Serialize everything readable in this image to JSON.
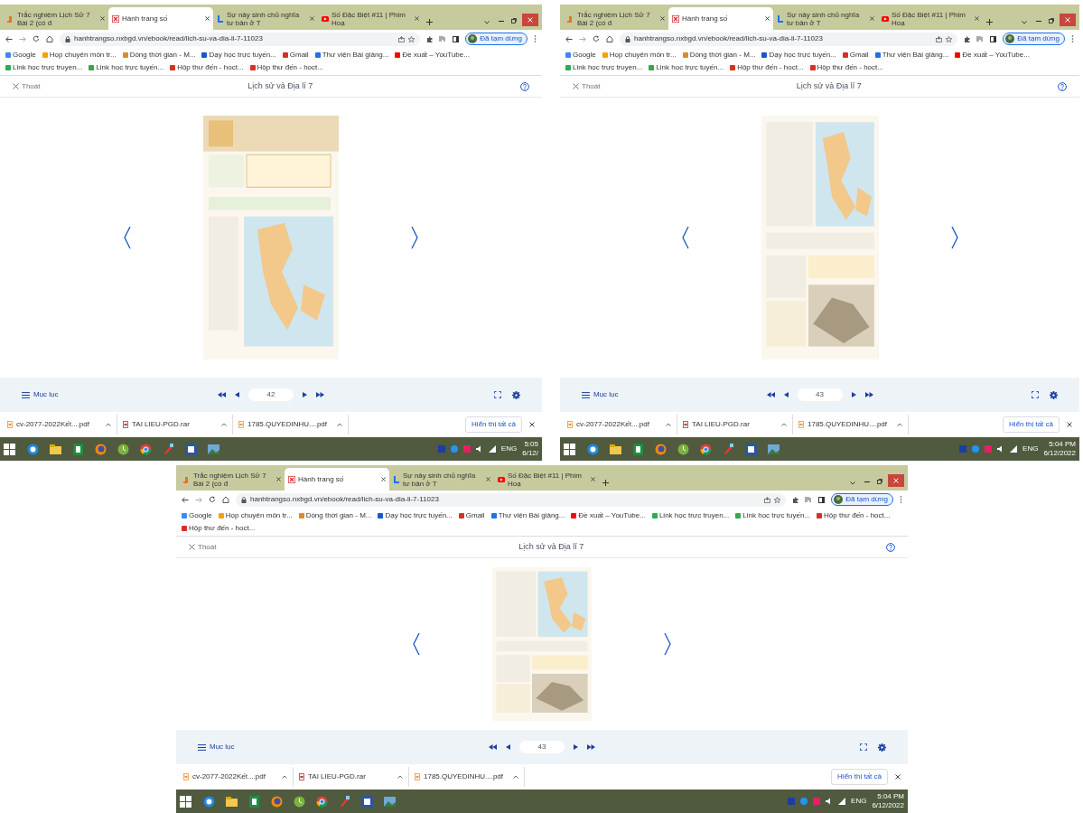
{
  "panels": [
    {
      "tabs": [
        {
          "label": "Trắc nghiệm Lịch Sử 7 Bài 2 (có đ",
          "selected": false
        },
        {
          "label": "Hành trang số",
          "selected": true
        },
        {
          "label": "Sự nảy sinh chủ nghĩa tư bản ở T",
          "selected": false
        },
        {
          "label": "Số Đặc Biệt #11 | Phim Hoạ",
          "selected": false
        }
      ],
      "url": "hanhtrangso.nxbgd.vn/ebook/read/lich-su-va-dia-li-7-11023",
      "profile": "Đã tạm dừng",
      "bookmarks": [
        "Google",
        "Họp chuyên môn tr...",
        "Dòng thời gian - M...",
        "Dạy học trực tuyến...",
        "Gmail",
        "Thư viện Bài giảng...",
        "Đề xuất – YouTube...",
        "Link học trực truyen...",
        "Link học trực tuyến...",
        "Hộp thư đến - hoct...",
        "Hộp thư đến - hoct..."
      ],
      "exit": "Thoát",
      "title": "Lịch sử và Địa lí 7",
      "toc": "Mục lục",
      "page": "42",
      "downloads": [
        "cv-2077-2022Kết....pdf",
        "TAI LIEU-PGD.rar",
        "1785.QUYEDINHU....pdf"
      ],
      "show_all": "Hiển thị tất cả",
      "lang": "ENG",
      "time": "5:05",
      "date": "6/12/"
    },
    {
      "tabs": [
        {
          "label": "Trắc nghiệm Lịch Sử 7 Bài 2 (có đ",
          "selected": false
        },
        {
          "label": "Hành trang số",
          "selected": true
        },
        {
          "label": "Sự nảy sinh chủ nghĩa tư bản ở T",
          "selected": false
        },
        {
          "label": "Số Đặc Biệt #11 | Phim Hoạ",
          "selected": false
        }
      ],
      "url": "hanhtrangso.nxbgd.vn/ebook/read/lich-su-va-dia-li-7-11023",
      "profile": "Đã tạm dừng",
      "bookmarks": [
        "Google",
        "Họp chuyên môn tr...",
        "Dòng thời gian - M...",
        "Dạy học trực tuyến...",
        "Gmail",
        "Thư viện Bài giảng...",
        "Đề xuất – YouTube...",
        "Link học trực truyen...",
        "Link học trực tuyến...",
        "Hộp thư đến - hoct...",
        "Hộp thư đến - hoct..."
      ],
      "exit": "Thoát",
      "title": "Lịch sử và Địa lí 7",
      "toc": "Mục lục",
      "page": "43",
      "downloads": [
        "cv-2077-2022Kết....pdf",
        "TAI LIEU-PGD.rar",
        "1785.QUYEDINHU....pdf"
      ],
      "show_all": "Hiển thị tất cả",
      "lang": "ENG",
      "time": "5:04 PM",
      "date": "6/12/2022"
    },
    {
      "tabs": [
        {
          "label": "Trắc nghiệm Lịch Sử 7 Bài 2 (có đ",
          "selected": false
        },
        {
          "label": "Hành trang số",
          "selected": true
        },
        {
          "label": "Sự nảy sinh chủ nghĩa tư bản ở T",
          "selected": false
        },
        {
          "label": "Số Đặc Biệt #11 | Phim Hoạ",
          "selected": false
        }
      ],
      "url": "hanhtrangso.nxbgd.vn/ebook/read/lich-su-va-dia-li-7-11023",
      "profile": "Đã tạm dừng",
      "bookmarks": [
        "Google",
        "Họp chuyên môn tr...",
        "Dòng thời gian - M...",
        "Dạy học trực tuyến...",
        "Gmail",
        "Thư viện Bài giảng...",
        "Đề xuất – YouTube...",
        "Link học trực truyen...",
        "Link học trực tuyến...",
        "Hộp thư đến - hoct...",
        "Hộp thư đến - hoct..."
      ],
      "exit": "Thoát",
      "title": "Lịch sử và Địa lí 7",
      "toc": "Mục lục",
      "page": "43",
      "downloads": [
        "cv-2077-2022Kết....pdf",
        "TAI LIEU-PGD.rar",
        "1785.QUYEDINHU....pdf"
      ],
      "show_all": "Hiển thị tất cả",
      "lang": "ENG",
      "time": "5:04 PM",
      "date": "6/12/2022"
    }
  ]
}
